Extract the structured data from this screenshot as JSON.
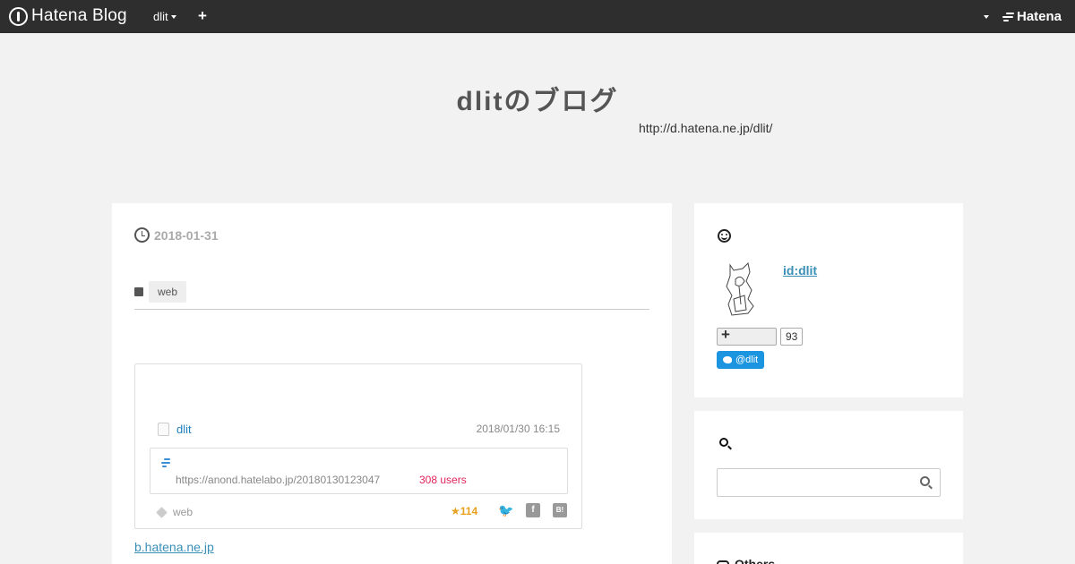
{
  "topbar": {
    "logo_text": "Hatena Blog",
    "user_menu_label": "dlit",
    "add_label": "+",
    "brand_label": "Hatena"
  },
  "blog": {
    "title": "dlitのブログ",
    "url": "http://d.hatena.ne.jp/dlit/"
  },
  "entry": {
    "date": "2018-01-31",
    "category": "web",
    "embed": {
      "username": "dlit",
      "timestamp": "2018/01/30 16:15",
      "link_url": "https://anond.hatelabo.jp/20180130123047",
      "users_count": "308 users",
      "tag": "web",
      "stars": "★114",
      "share_icons": [
        "twitter-icon",
        "facebook-icon",
        "hatena-bookmark-icon"
      ]
    },
    "source_link": "b.hatena.ne.jp"
  },
  "sidebar": {
    "profile": {
      "id_label": "id:dlit",
      "follow_count": "93",
      "twitter_label": "@dlit"
    },
    "search": {
      "placeholder": ""
    },
    "others": {
      "heading": "Others"
    }
  },
  "colors": {
    "topbar_bg": "#2e2e2e",
    "page_bg": "#f2f2f2",
    "link": "#3a8fb7",
    "users_count": "#e0245e",
    "stars": "#e6a11e",
    "twitter": "#1b95e0"
  }
}
